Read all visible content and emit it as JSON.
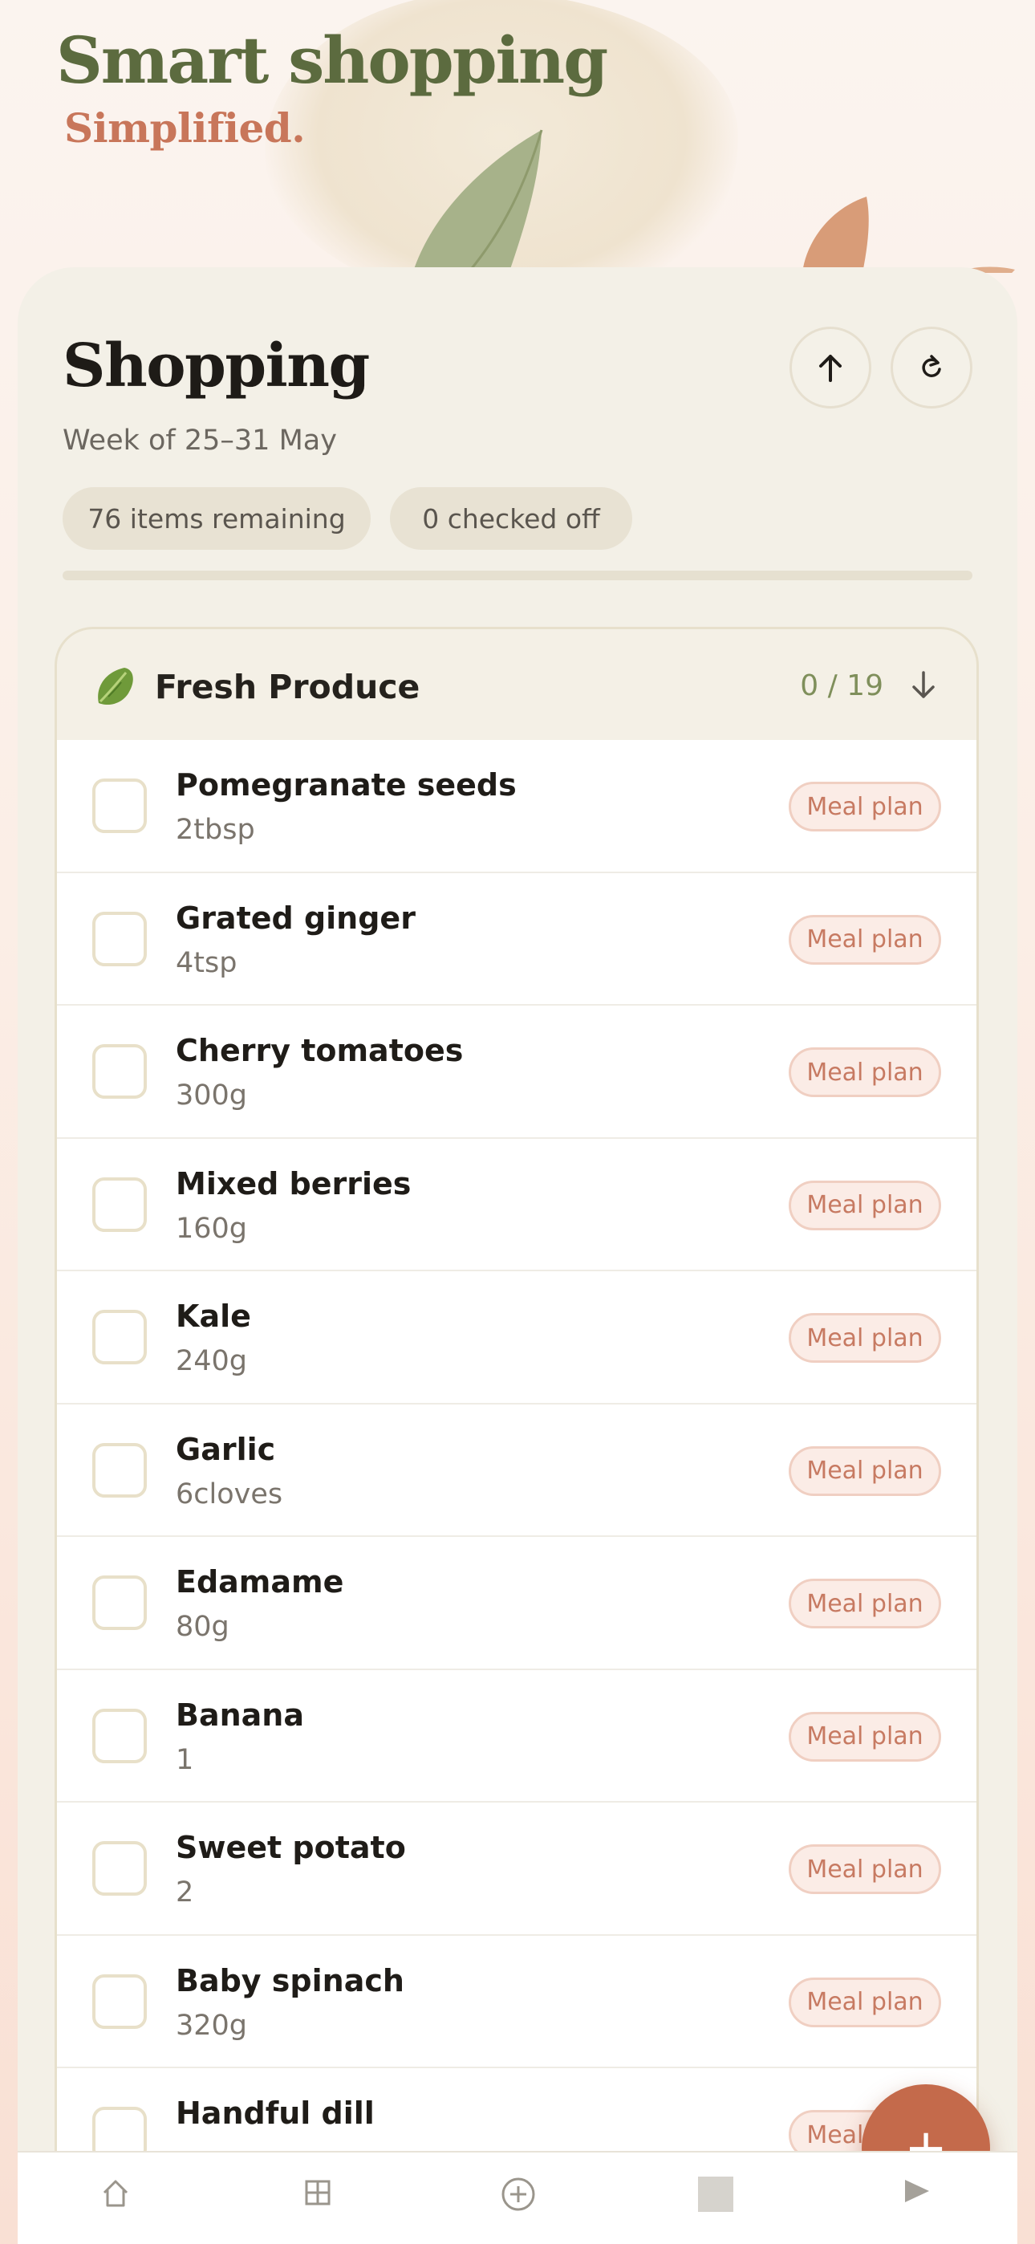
{
  "hero": {
    "title": "Smart shopping",
    "subtitle": "Simplified."
  },
  "header": {
    "title": "Shopping",
    "week": "Week of 25–31 May",
    "share_icon": "arrow-up-icon",
    "refresh_icon": "refresh-icon"
  },
  "stats": {
    "remaining": "76 items remaining",
    "checked": "0 checked off",
    "progress_fraction": 0
  },
  "section": {
    "icon": "lettuce-leaf-icon",
    "title": "Fresh Produce",
    "count": "0 / 19",
    "items": [
      {
        "name": "Pomegranate seeds",
        "qty": "2tbsp",
        "badge": "Meal plan"
      },
      {
        "name": "Grated ginger",
        "qty": "4tsp",
        "badge": "Meal plan"
      },
      {
        "name": "Cherry tomatoes",
        "qty": "300g",
        "badge": "Meal plan"
      },
      {
        "name": "Mixed berries",
        "qty": "160g",
        "badge": "Meal plan"
      },
      {
        "name": "Kale",
        "qty": "240g",
        "badge": "Meal plan"
      },
      {
        "name": "Garlic",
        "qty": "6cloves",
        "badge": "Meal plan"
      },
      {
        "name": "Edamame",
        "qty": "80g",
        "badge": "Meal plan"
      },
      {
        "name": "Banana",
        "qty": "1",
        "badge": "Meal plan"
      },
      {
        "name": "Sweet potato",
        "qty": "2",
        "badge": "Meal plan"
      },
      {
        "name": "Baby spinach",
        "qty": "320g",
        "badge": "Meal plan"
      },
      {
        "name": "Handful dill",
        "qty": "",
        "badge": "Meal plan"
      }
    ]
  },
  "fab": {
    "label": "+"
  },
  "tabbar": {
    "tabs": [
      "home-icon",
      "grid-icon",
      "add-circle-icon",
      "square-icon",
      "play-icon"
    ]
  },
  "colors": {
    "accent": "#c46a4b",
    "olive": "#5c6b3f",
    "badge_text": "#c77a62"
  }
}
